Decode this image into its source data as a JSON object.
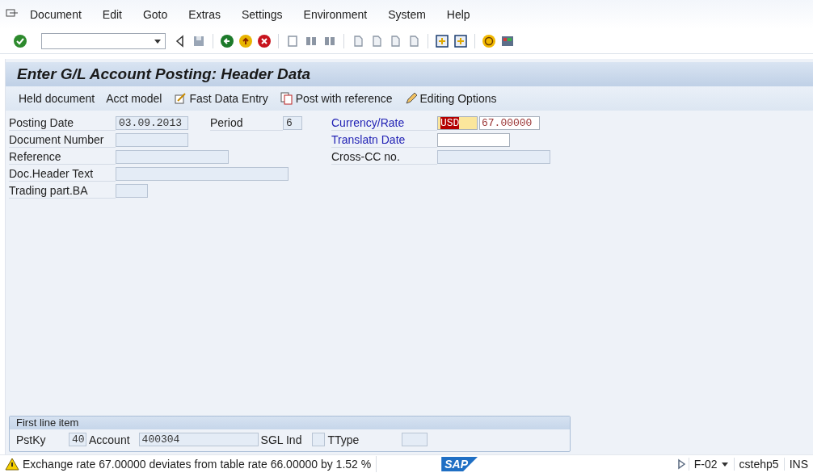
{
  "menu": [
    {
      "label": "Document"
    },
    {
      "label": "Edit"
    },
    {
      "label": "Goto"
    },
    {
      "label": "Extras"
    },
    {
      "label": "Settings"
    },
    {
      "label": "Environment"
    },
    {
      "label": "System"
    },
    {
      "label": "Help"
    }
  ],
  "title": "Enter G/L Account Posting: Header Data",
  "app_toolbar": [
    {
      "label": "Held document",
      "kind": "text"
    },
    {
      "label": "Acct model",
      "kind": "text"
    },
    {
      "label": "Fast Data Entry",
      "kind": "fast"
    },
    {
      "label": "Post with reference",
      "kind": "copy"
    },
    {
      "label": "Editing Options",
      "kind": "pencil"
    }
  ],
  "left_fields": [
    {
      "label": "Posting Date",
      "value": "03.09.2013",
      "editable": false
    },
    {
      "label": "Document Number",
      "editable": false
    },
    {
      "label": "Reference",
      "editable": false
    },
    {
      "label": "Doc.Header Text",
      "editable": false
    },
    {
      "label": "Trading part.BA",
      "editable": false
    }
  ],
  "period": {
    "label": "Period",
    "value": "6",
    "editable": false
  },
  "right_fields": [
    {
      "label": "Currency/Rate",
      "kind": "link",
      "value": "USD",
      "focused": true,
      "highlighted": true,
      "second_value": "67.00000"
    },
    {
      "label": "Translatn Date",
      "kind": "link",
      "editable": true
    },
    {
      "label": "Cross-CC no.",
      "kind": "plain",
      "editable": false
    }
  ],
  "first_line_item": {
    "title": "First line item",
    "fields": [
      {
        "label": "PstKy",
        "value": "40"
      },
      {
        "label": "Account",
        "value": "400304"
      },
      {
        "label": "SGL Ind"
      },
      {
        "label": "TType"
      }
    ]
  },
  "status_bar": {
    "kind": "warning",
    "message": "Exchange rate  67.00000 deviates from table rate  66.00000 by 1.52 %",
    "logo": "SAP",
    "transaction": "F-02",
    "user": "cstehp5",
    "mode": "INS"
  }
}
